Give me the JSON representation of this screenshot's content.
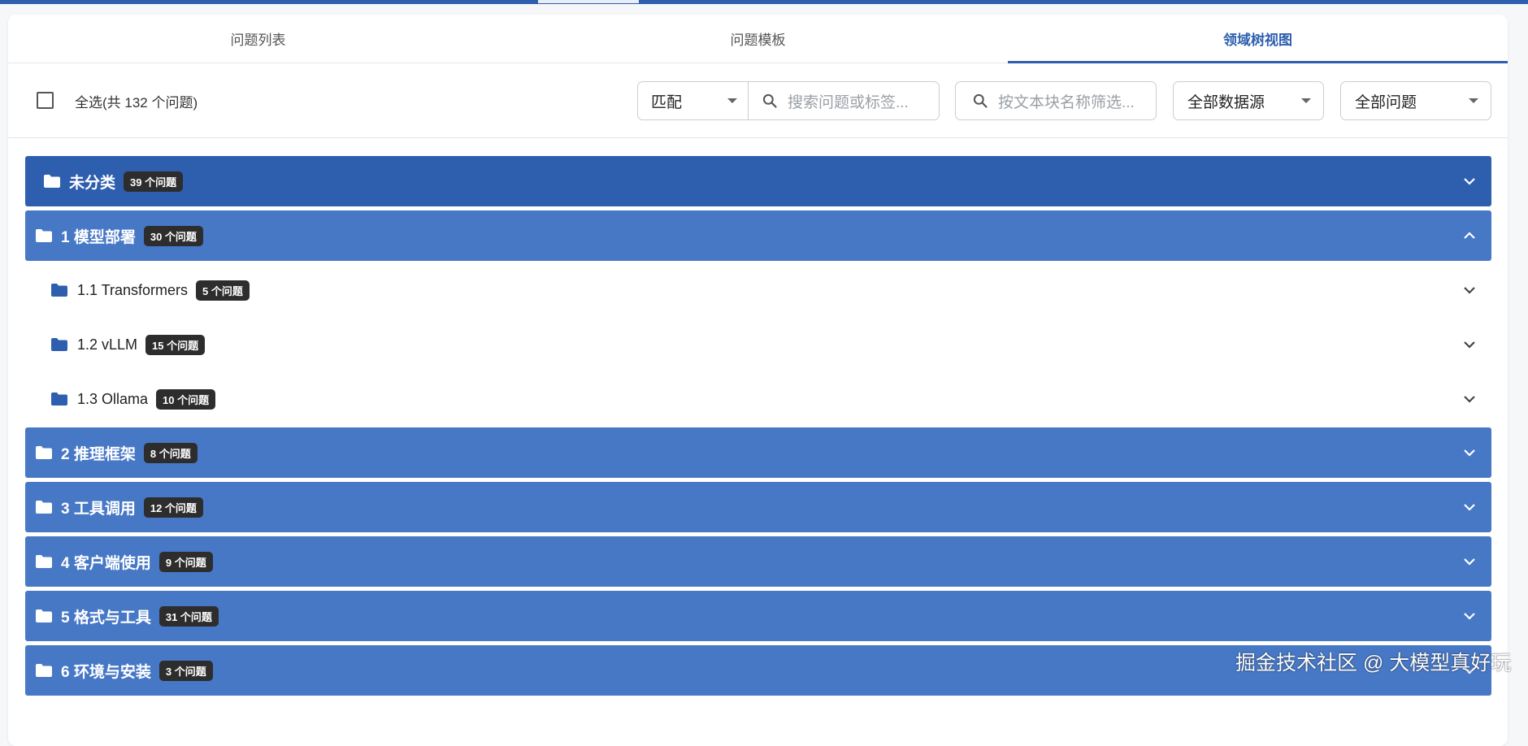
{
  "tabs": [
    {
      "label": "问题列表",
      "active": false
    },
    {
      "label": "问题模板",
      "active": false
    },
    {
      "label": "领域树视图",
      "active": true
    }
  ],
  "toolbar": {
    "select_all_label": "全选(共 132 个问题)",
    "match_select_value": "匹配",
    "search_placeholder": "搜索问题或标签...",
    "block_filter_placeholder": "按文本块名称筛选...",
    "datasource_select_value": "全部数据源",
    "question_select_value": "全部问题"
  },
  "tree": [
    {
      "label": "未分类",
      "badge": "39 个问题",
      "level": 0,
      "expanded": false
    },
    {
      "label": "1 模型部署",
      "badge": "30 个问题",
      "level": 0,
      "expanded": true
    },
    {
      "label": "1.1 Transformers",
      "badge": "5 个问题",
      "level": 1,
      "expanded": false
    },
    {
      "label": "1.2 vLLM",
      "badge": "15 个问题",
      "level": 1,
      "expanded": false
    },
    {
      "label": "1.3 Ollama",
      "badge": "10 个问题",
      "level": 1,
      "expanded": false
    },
    {
      "label": "2 推理框架",
      "badge": "8 个问题",
      "level": 0,
      "expanded": false
    },
    {
      "label": "3 工具调用",
      "badge": "12 个问题",
      "level": 0,
      "expanded": false
    },
    {
      "label": "4 客户端使用",
      "badge": "9 个问题",
      "level": 0,
      "expanded": false
    },
    {
      "label": "5 格式与工具",
      "badge": "31 个问题",
      "level": 0,
      "expanded": false
    },
    {
      "label": "6 环境与安装",
      "badge": "3 个问题",
      "level": 0,
      "expanded": false
    }
  ],
  "watermark": "掘金技术社区 @ 大模型真好玩",
  "colors": {
    "primary": "#2e5faf",
    "group_bg": "#4778c6",
    "badge_bg": "#2d2d2d"
  },
  "icons": {
    "folder": "folder-icon",
    "search": "search-icon",
    "chevron_down": "chevron-down-icon",
    "chevron_up": "chevron-up-icon"
  }
}
